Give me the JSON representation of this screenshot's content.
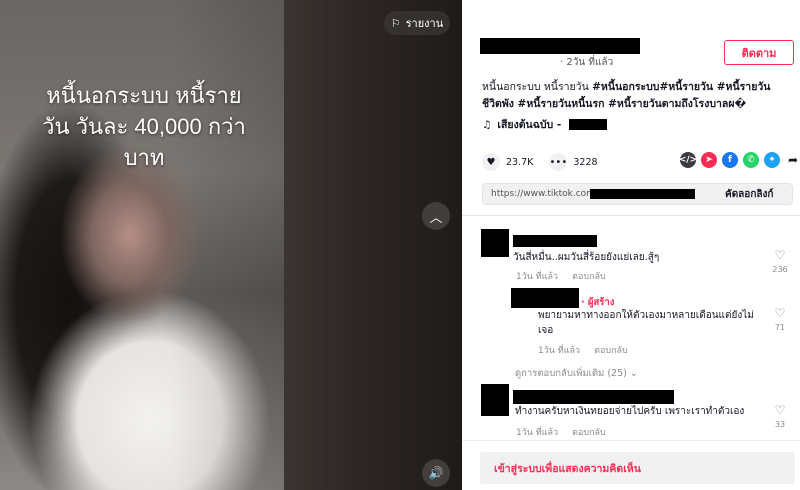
{
  "video": {
    "overlay_text": "หนี้นอกระบบ หนี้ราย\nวัน วันละ 40,000 กว่า\nบาท",
    "report_label": "รายงาน"
  },
  "author": {
    "subtitle": "· 2วัน ที่แล้ว",
    "follow_label": "ติดตาม"
  },
  "description": {
    "text": "หนี้นอกระบบ หนี้รายวัน ",
    "hashtags": "#หนี้นอกระบบ#หนี้รายวัน #หนี้รายวันชีวิตพัง #หนี้รายวันหนี้นรก #หนี้รายวันตามถึงโรงบาลผ�"
  },
  "music": {
    "label": "เสียงต้นฉบับ -"
  },
  "stats": {
    "likes": "23.7K",
    "comments": "3228"
  },
  "link": {
    "url": "https://www.tiktok.com/@",
    "copy_label": "คัดลอกลิงก์"
  },
  "comments": [
    {
      "text": "วันสี่หมื่น..ผมวันสี่ร้อยยังแย่เลย.สู้ๆ",
      "time": "1วัน ที่แล้ว",
      "reply": "ตอบกลับ",
      "likes": "236"
    },
    {
      "creator_tag": "· ผู้สร้าง",
      "text": "พยายามหาทางออกให้ตัวเองมาหลายเดือนแต่ยังไม่เจอ",
      "time": "1วัน ที่แล้ว",
      "reply": "ตอบกลับ",
      "likes": "71"
    },
    {
      "text": "ทำงานครับหาเงินทยอยจ่ายไปครับ เพราะเราทำตัวเอง",
      "time": "1วัน ที่แล้ว",
      "reply": "ตอบกลับ",
      "likes": "33"
    }
  ],
  "more_replies": "ดูการตอบกลับเพิ่มเติม (25) ⌄",
  "login_prompt": "เข้าสู่ระบบเพื่อแสดงความคิดเห็น",
  "colors": {
    "accent": "#fe2c55",
    "telegram": "#fe2c55",
    "facebook": "#1877f2",
    "whatsapp": "#25d366",
    "twitter": "#1da1f2"
  },
  "icons": [
    "flag-icon",
    "chevron-up-icon",
    "volume-icon",
    "heart-icon",
    "comment-icon",
    "embed-icon",
    "send-icon",
    "facebook-icon",
    "whatsapp-icon",
    "twitter-icon",
    "share-arrow-icon",
    "music-note-icon"
  ]
}
